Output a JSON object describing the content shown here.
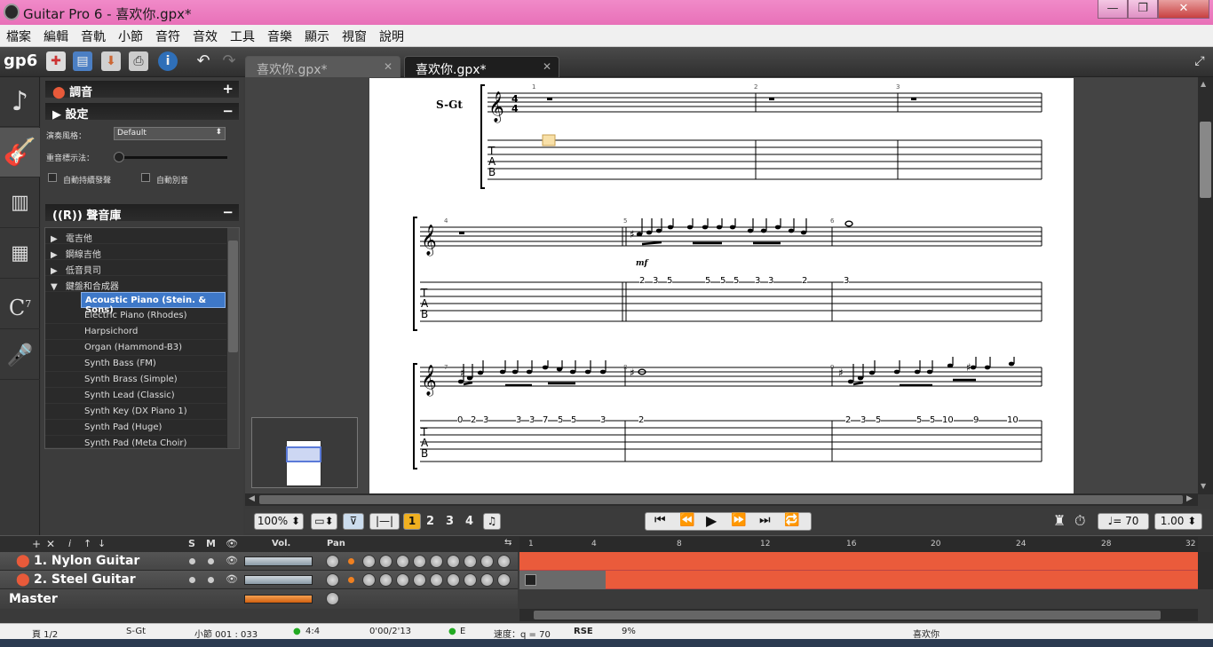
{
  "window": {
    "title": "Guitar Pro 6 - 喜欢你.gpx*",
    "minimize": "—",
    "restore": "❐",
    "close": "✕"
  },
  "menu": [
    "檔案",
    "編輯",
    "音軌",
    "小節",
    "音符",
    "音效",
    "工具",
    "音樂",
    "顯示",
    "視窗",
    "說明"
  ],
  "toolbar": {
    "logo": "gp6"
  },
  "tabs": [
    {
      "label": "喜欢你.gpx*",
      "active": false
    },
    {
      "label": "喜欢你.gpx*",
      "active": true
    }
  ],
  "panel": {
    "tuning_header": "調音",
    "settings_header": "設定",
    "style_label": "演奏風格：",
    "style_value": "Default",
    "slider_label": "重音標示法：",
    "auto_sustain": "自動持續發聲",
    "auto_mute": "自動別音",
    "soundbank_header": "聲音庫",
    "categories": [
      {
        "label": "電吉他",
        "expanded": false
      },
      {
        "label": "鋼線吉他",
        "expanded": false
      },
      {
        "label": "低音貝司",
        "expanded": false
      },
      {
        "label": "鍵盤和合成器",
        "expanded": true
      }
    ],
    "sounds": [
      "Acoustic Piano (Stein. & Sons)",
      "Electric Piano (Rhodes)",
      "Harpsichord",
      "Organ (Hammond-B3)",
      "Synth Bass (FM)",
      "Synth Brass (Simple)",
      "Synth Lead (Classic)",
      "Synth Key (DX Piano 1)",
      "Synth Pad (Huge)",
      "Synth Pad (Meta Choir)"
    ],
    "selected_sound": "Acoustic Piano (Stein. & Sons)"
  },
  "score": {
    "track_label": "S-Gt",
    "time_signature": "4/4",
    "dynamic": "mf",
    "bar_numbers": [
      "1",
      "2",
      "3",
      "4",
      "5",
      "6",
      "7",
      "8",
      "9"
    ],
    "tab_row2_frets": [
      "2",
      "3",
      "5",
      "5",
      "5",
      "5",
      "3",
      "3",
      "2",
      "3"
    ],
    "tab_row3_frets": [
      "0",
      "2",
      "3",
      "3",
      "3",
      "7",
      "5",
      "5",
      "3",
      "2",
      "2",
      "3",
      "5",
      "5",
      "5",
      "10",
      "9",
      "10"
    ]
  },
  "bottombar": {
    "zoom": "100%",
    "voices": [
      "1",
      "2",
      "3",
      "4"
    ],
    "tempo_value": "= 70",
    "speed": "1.00"
  },
  "tracks": {
    "header": {
      "solo": "S",
      "mute": "M",
      "vol": "Vol.",
      "pan": "Pan"
    },
    "ruler": [
      "1",
      "4",
      "8",
      "12",
      "16",
      "20",
      "24",
      "28",
      "32"
    ],
    "rows": [
      {
        "name": "1. Nylon Guitar"
      },
      {
        "name": "2. Steel Guitar"
      }
    ],
    "master": "Master"
  },
  "status": {
    "page": "頁 1/2",
    "track": "S-Gt",
    "bar": "小節 001 : 033",
    "time_sig": "4:4",
    "time": "0'00/2'13",
    "key": "E",
    "tempo": "速度：q = 70",
    "rse": "RSE",
    "cpu": "9%",
    "song": "喜欢你"
  },
  "colors": {
    "accent": "#ea5b3b",
    "selection": "#3e78c8",
    "titlebar": "#e870b8"
  }
}
